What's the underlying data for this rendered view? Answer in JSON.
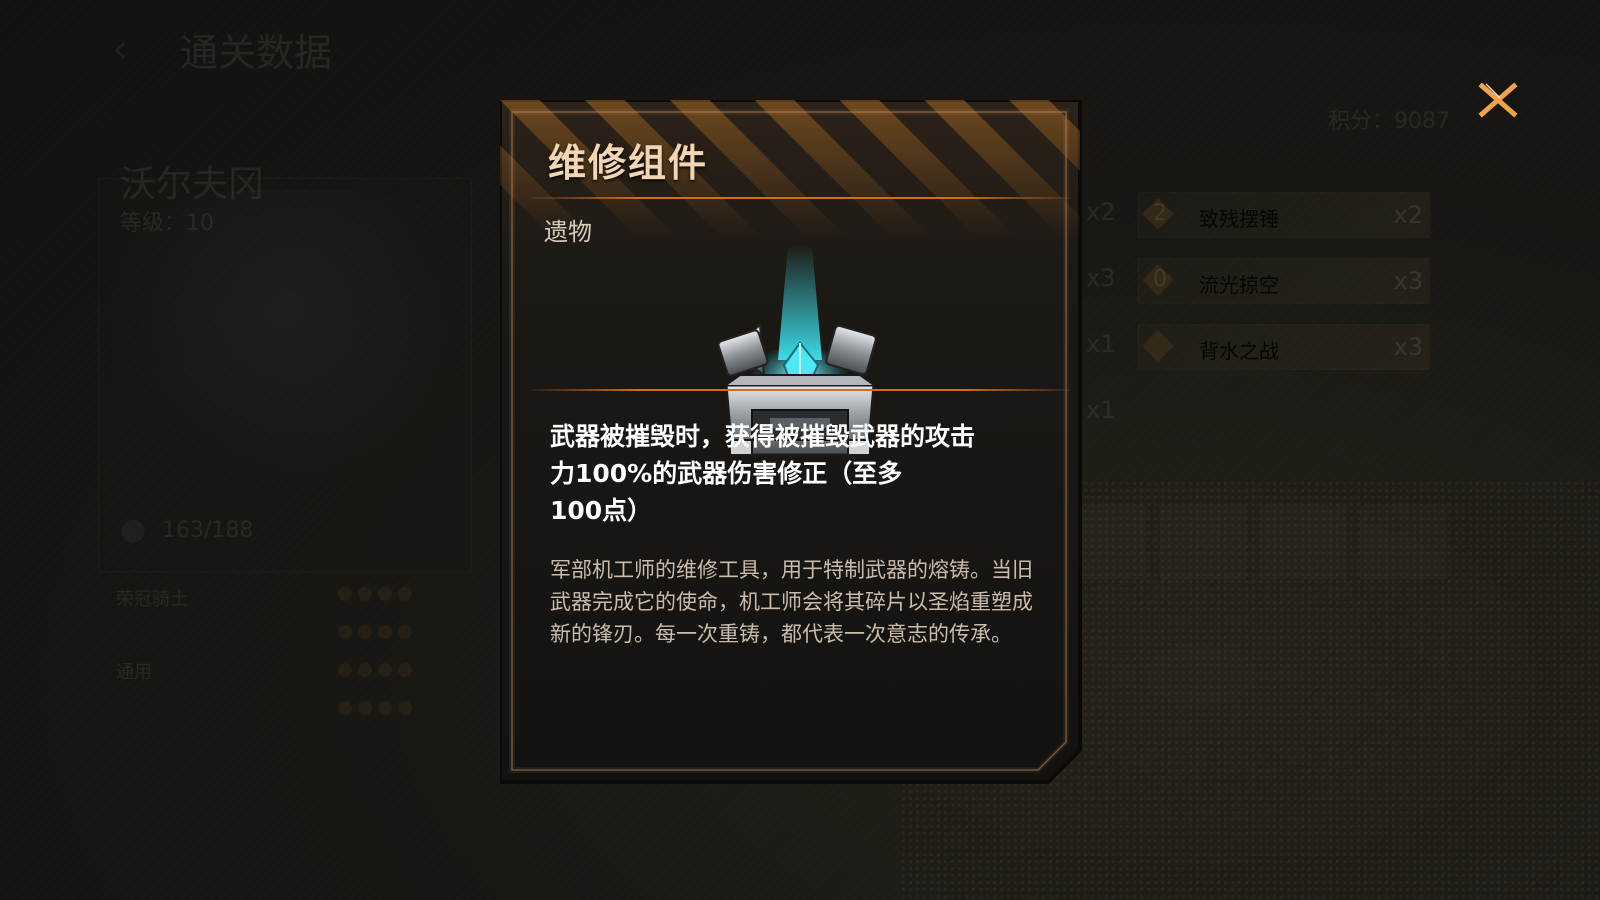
{
  "background": {
    "back_arrow": "‹",
    "title": "通关数据",
    "character_name": "沃尔夫冈",
    "level": "等级：10",
    "hp": "163/188",
    "stat_label_1": "荣冠骑士",
    "stat_label_2": "通用",
    "score": "积分：9087",
    "left_counts": [
      "x2",
      "x3",
      "x1",
      "x1"
    ],
    "rows": [
      {
        "num": "2",
        "label": "致残摆锤",
        "count": "x2"
      },
      {
        "num": "0",
        "label": "流光掠空",
        "count": "x3"
      },
      {
        "num": "",
        "label": "背水之战",
        "count": "x3"
      }
    ]
  },
  "close_button": {
    "icon": "close-icon"
  },
  "item": {
    "name": "维修组件",
    "type": "遗物",
    "icon": "repair-kit-chest-icon",
    "effect_lines": [
      "武器被摧毁时，获得被摧毁武器的攻击",
      "力100%的武器伤害修正（至多",
      "100点）"
    ],
    "lore": "军部机工师的维修工具，用于特制武器的熔铸。当旧武器完成它的使命，机工师会将其碎片以圣焰重塑成新的锋刃。每一次重铸，都代表一次意志的传承。"
  },
  "colors": {
    "accent_orange": "#c96f26",
    "title_text": "#f2d6b4",
    "glow_cyan": "#3ff0ff"
  }
}
